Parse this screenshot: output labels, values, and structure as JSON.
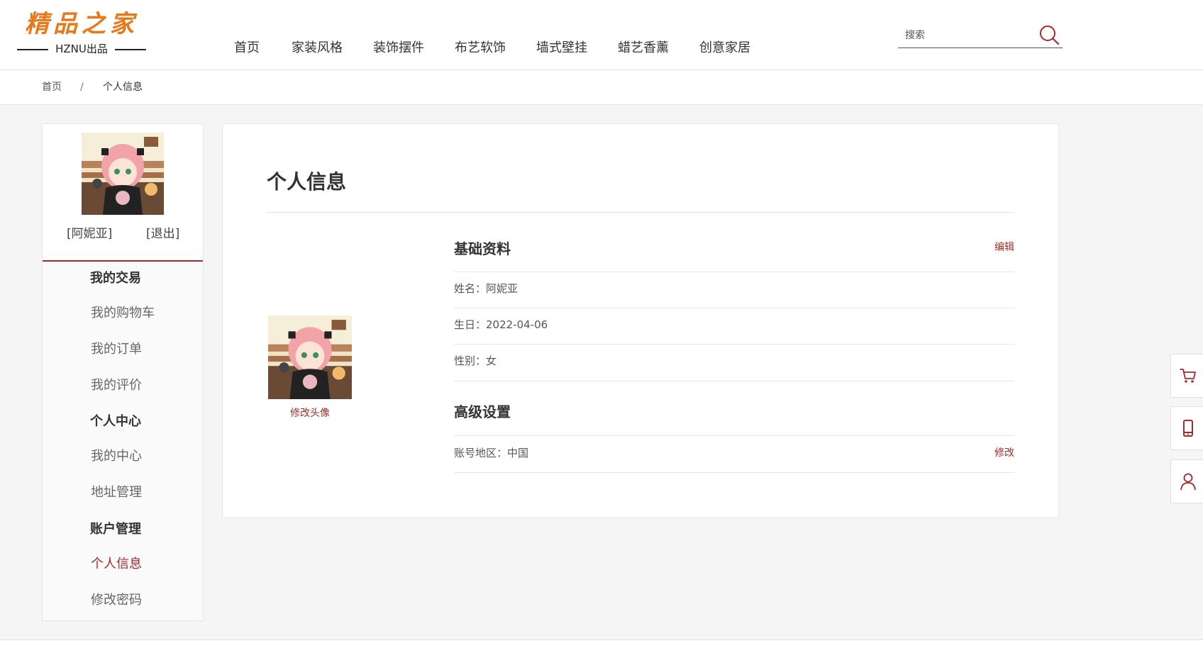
{
  "logo": {
    "title": "精品之家",
    "subtitle": "HZNU出品"
  },
  "nav": {
    "items": [
      {
        "label": "首页"
      },
      {
        "label": "家装风格"
      },
      {
        "label": "装饰摆件"
      },
      {
        "label": "布艺软饰"
      },
      {
        "label": "墙式壁挂"
      },
      {
        "label": "蜡艺香薰"
      },
      {
        "label": "创意家居"
      }
    ]
  },
  "search": {
    "placeholder": "搜索",
    "value": "",
    "icon": "search-icon"
  },
  "breadcrumb": {
    "home": "首页",
    "separator": "/",
    "current": "个人信息"
  },
  "sidebar": {
    "user_name": "[阿妮亚]",
    "logout": "[退出]",
    "groups": [
      {
        "title": "我的交易",
        "items": [
          "我的购物车",
          "我的订单",
          "我的评价"
        ]
      },
      {
        "title": "个人中心",
        "items": [
          "我的中心",
          "地址管理"
        ]
      },
      {
        "title": "账户管理",
        "items": [
          "个人信息",
          "修改密码"
        ]
      }
    ],
    "active_item": "个人信息"
  },
  "main": {
    "title": "个人信息",
    "change_avatar": "修改头像",
    "basic": {
      "title": "基础资料",
      "edit": "编辑",
      "name": "姓名：阿妮亚",
      "birthday": "生日：2022-04-06",
      "gender": "性别：女"
    },
    "advanced": {
      "title": "高级设置",
      "region": "账号地区：中国",
      "modify": "修改"
    }
  },
  "float_tools": [
    "cart-icon",
    "phone-icon",
    "user-icon"
  ],
  "colors": {
    "accent": "#a52a2a",
    "logo": "#e8791a",
    "background": "#f5f5f5"
  }
}
